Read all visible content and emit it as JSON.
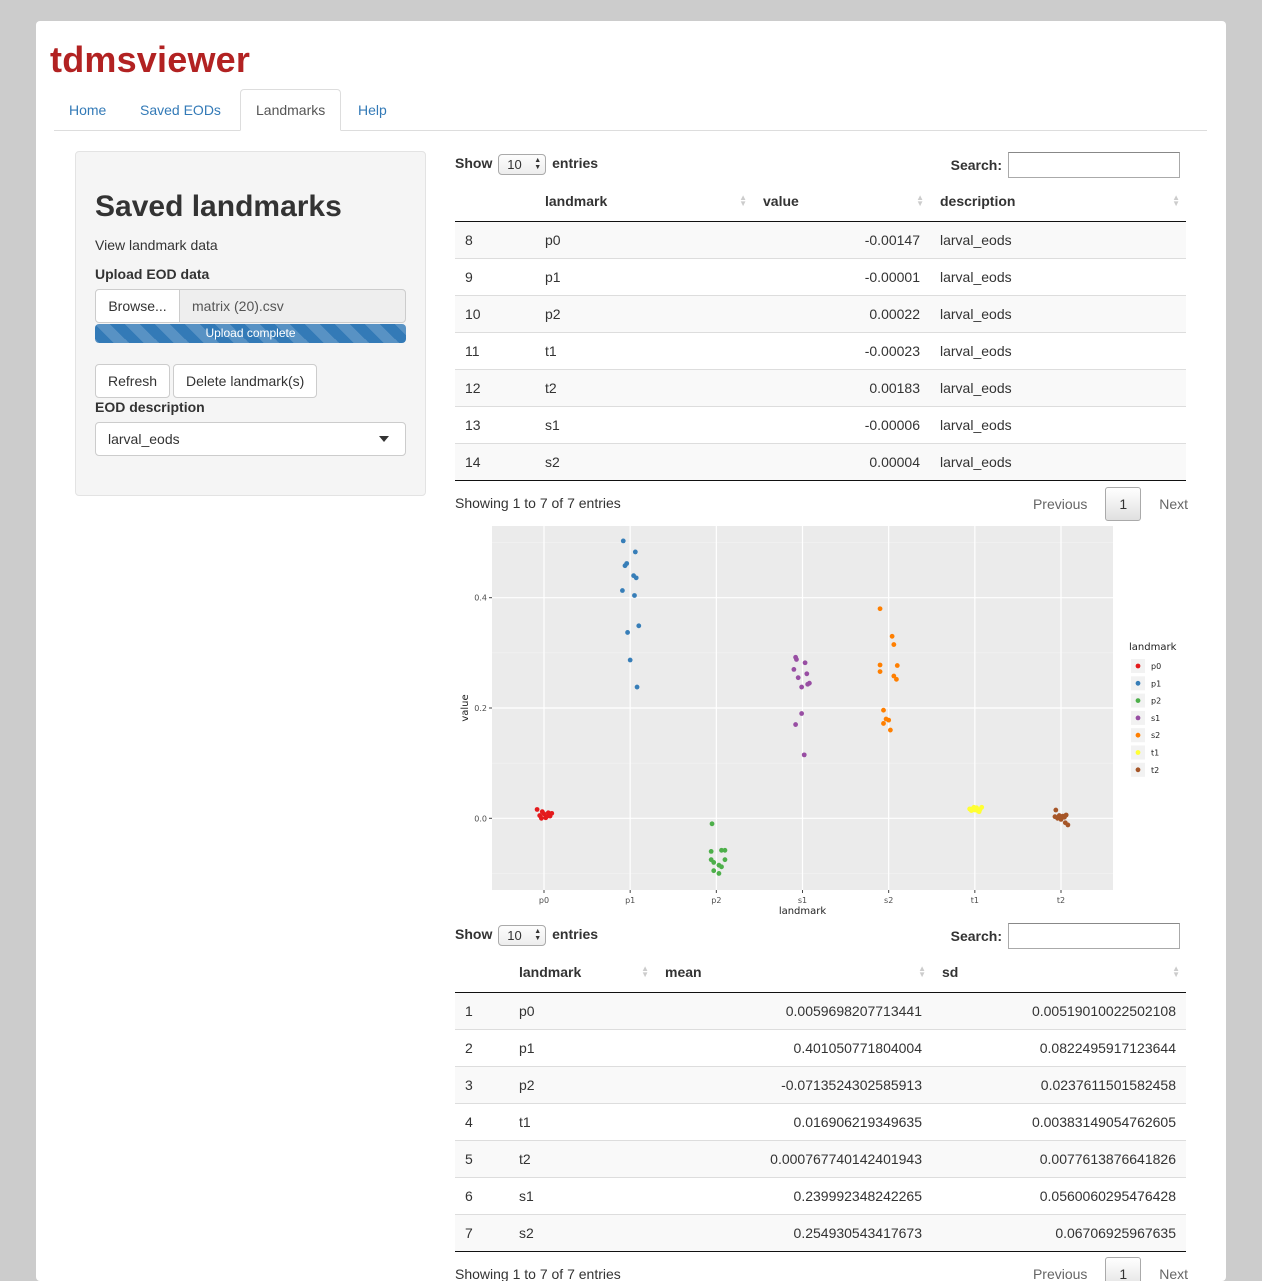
{
  "app": {
    "title": "tdmsviewer"
  },
  "tabs": [
    {
      "label": "Home"
    },
    {
      "label": "Saved EODs"
    },
    {
      "label": "Landmarks"
    },
    {
      "label": "Help"
    }
  ],
  "active_tab": "Landmarks",
  "sidebar": {
    "title": "Saved landmarks",
    "subtitle": "View landmark data",
    "upload_label": "Upload EOD data",
    "browse_label": "Browse...",
    "file_name": "matrix (20).csv",
    "progress_text": "Upload complete",
    "progress_fraction": 1.0,
    "refresh_label": "Refresh",
    "delete_label": "Delete landmark(s)",
    "eod_label": "EOD description",
    "eod_selected": "larval_eods"
  },
  "table1": {
    "show_label": "Show",
    "length": "10",
    "entries_label": "entries",
    "search_label": "Search:",
    "headers": [
      "",
      "landmark",
      "value",
      "description"
    ],
    "rows": [
      [
        "8",
        "p0",
        "-0.00147",
        "larval_eods"
      ],
      [
        "9",
        "p1",
        "-0.00001",
        "larval_eods"
      ],
      [
        "10",
        "p2",
        "0.00022",
        "larval_eods"
      ],
      [
        "11",
        "t1",
        "-0.00023",
        "larval_eods"
      ],
      [
        "12",
        "t2",
        "0.00183",
        "larval_eods"
      ],
      [
        "13",
        "s1",
        "-0.00006",
        "larval_eods"
      ],
      [
        "14",
        "s2",
        "0.00004",
        "larval_eods"
      ]
    ],
    "info": "Showing 1 to 7 of 7 entries",
    "previous_label": "Previous",
    "page": "1",
    "next_label": "Next"
  },
  "chart_data": {
    "type": "scatter",
    "xlabel": "landmark",
    "ylabel": "value",
    "categories": [
      "p0",
      "p1",
      "p2",
      "s1",
      "s2",
      "t1",
      "t2"
    ],
    "yticks": [
      "0.0",
      "0.2",
      "0.4"
    ],
    "ylim": [
      -0.13,
      0.53
    ],
    "grid": true,
    "legend": {
      "title": "landmark",
      "position": "right"
    },
    "series": [
      {
        "name": "p0",
        "color": "#e41a1c",
        "points": [
          [
            -0.08,
            0.016
          ],
          [
            -0.05,
            0.005
          ],
          [
            -0.03,
            0.0
          ],
          [
            0.0,
            0.008
          ],
          [
            0.03,
            0.003
          ],
          [
            0.05,
            0.01
          ],
          [
            0.07,
            0.004
          ],
          [
            0.09,
            0.009
          ],
          [
            -0.02,
            0.012
          ],
          [
            0.02,
            0.001
          ]
        ]
      },
      {
        "name": "p1",
        "color": "#377eb8",
        "points": [
          [
            -0.08,
            0.503
          ],
          [
            0.06,
            0.483
          ],
          [
            -0.04,
            0.462
          ],
          [
            -0.06,
            0.458
          ],
          [
            0.04,
            0.44
          ],
          [
            0.07,
            0.436
          ],
          [
            -0.09,
            0.413
          ],
          [
            0.05,
            0.404
          ],
          [
            0.1,
            0.349
          ],
          [
            -0.03,
            0.337
          ],
          [
            0.0,
            0.287
          ],
          [
            0.08,
            0.238
          ]
        ]
      },
      {
        "name": "p2",
        "color": "#4daf4a",
        "points": [
          [
            -0.05,
            -0.01
          ],
          [
            -0.06,
            -0.06
          ],
          [
            0.06,
            -0.058
          ],
          [
            0.1,
            -0.058
          ],
          [
            0.1,
            -0.075
          ],
          [
            -0.06,
            -0.075
          ],
          [
            -0.03,
            -0.08
          ],
          [
            0.03,
            -0.085
          ],
          [
            0.06,
            -0.088
          ],
          [
            -0.03,
            -0.095
          ],
          [
            0.03,
            -0.1
          ]
        ]
      },
      {
        "name": "s1",
        "color": "#984ea3",
        "points": [
          [
            -0.08,
            0.292
          ],
          [
            -0.07,
            0.288
          ],
          [
            0.03,
            0.282
          ],
          [
            -0.1,
            0.27
          ],
          [
            0.05,
            0.262
          ],
          [
            -0.05,
            0.255
          ],
          [
            0.08,
            0.245
          ],
          [
            0.06,
            0.243
          ],
          [
            -0.01,
            0.238
          ],
          [
            -0.01,
            0.19
          ],
          [
            -0.08,
            0.17
          ],
          [
            0.02,
            0.115
          ]
        ]
      },
      {
        "name": "s2",
        "color": "#ff7f00",
        "points": [
          [
            -0.1,
            0.38
          ],
          [
            0.04,
            0.33
          ],
          [
            0.06,
            0.315
          ],
          [
            -0.1,
            0.278
          ],
          [
            0.1,
            0.277
          ],
          [
            -0.1,
            0.266
          ],
          [
            0.06,
            0.258
          ],
          [
            0.09,
            0.252
          ],
          [
            -0.06,
            0.196
          ],
          [
            -0.03,
            0.18
          ],
          [
            0.0,
            0.178
          ],
          [
            -0.06,
            0.172
          ],
          [
            0.02,
            0.16
          ]
        ]
      },
      {
        "name": "t1",
        "color": "#ffff33",
        "points": [
          [
            -0.06,
            0.017
          ],
          [
            -0.04,
            0.014
          ],
          [
            -0.02,
            0.018
          ],
          [
            0.0,
            0.015
          ],
          [
            0.02,
            0.019
          ],
          [
            0.04,
            0.013
          ],
          [
            0.06,
            0.016
          ],
          [
            0.08,
            0.02
          ],
          [
            0.05,
            0.012
          ],
          [
            -0.01,
            0.02
          ]
        ]
      },
      {
        "name": "t2",
        "color": "#a65628",
        "points": [
          [
            -0.06,
            0.015
          ],
          [
            -0.04,
            0.0
          ],
          [
            -0.02,
            0.005
          ],
          [
            0.0,
            -0.002
          ],
          [
            0.02,
            0.004
          ],
          [
            0.04,
            0.002
          ],
          [
            0.06,
            0.006
          ],
          [
            0.08,
            -0.012
          ],
          [
            0.05,
            -0.008
          ],
          [
            -0.07,
            0.003
          ],
          [
            0.01,
            0.001
          ]
        ]
      }
    ]
  },
  "table2": {
    "show_label": "Show",
    "length": "10",
    "entries_label": "entries",
    "search_label": "Search:",
    "headers": [
      "",
      "landmark",
      "mean",
      "sd"
    ],
    "rows": [
      [
        "1",
        "p0",
        "0.0059698207713441",
        "0.00519010022502108"
      ],
      [
        "2",
        "p1",
        "0.401050771804004",
        "0.0822495917123644"
      ],
      [
        "3",
        "p2",
        "-0.0713524302585913",
        "0.0237611501582458"
      ],
      [
        "4",
        "t1",
        "0.016906219349635",
        "0.00383149054762605"
      ],
      [
        "5",
        "t2",
        "0.000767740142401943",
        "0.0077613876641826"
      ],
      [
        "6",
        "s1",
        "0.239992348242265",
        "0.0560060295476428"
      ],
      [
        "7",
        "s2",
        "0.254930543417673",
        "0.06706925967635"
      ]
    ],
    "info": "Showing 1 to 7 of 7 entries",
    "previous_label": "Previous",
    "page": "1",
    "next_label": "Next"
  }
}
